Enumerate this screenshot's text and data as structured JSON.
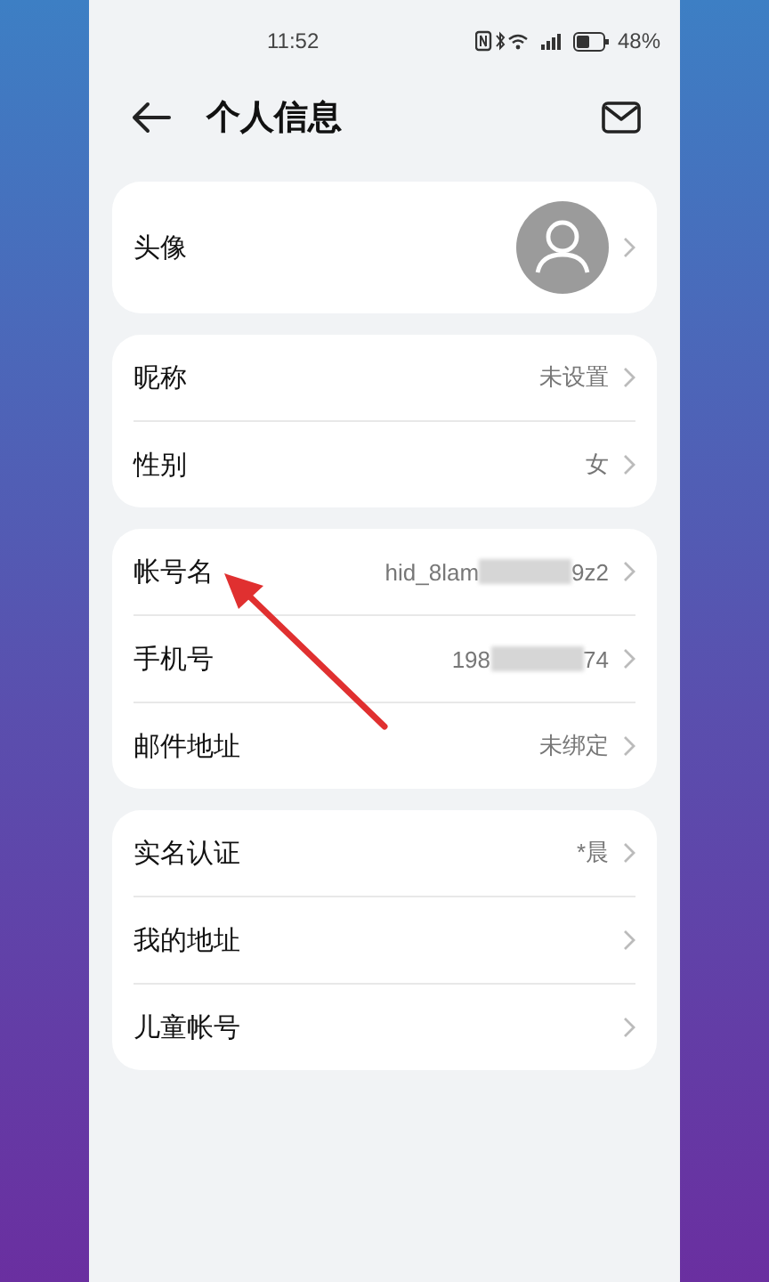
{
  "status_bar": {
    "time": "11:52",
    "battery": "48%",
    "battery_meter": {
      "level": 0.48
    }
  },
  "header": {
    "title": "个人信息"
  },
  "groups": [
    {
      "rows": [
        {
          "kind": "avatar",
          "label": "头像"
        }
      ]
    },
    {
      "rows": [
        {
          "kind": "text",
          "label": "昵称",
          "value": [
            {
              "kind": "text",
              "text": "未设置"
            }
          ]
        },
        {
          "kind": "text",
          "label": "性别",
          "value": [
            {
              "kind": "text",
              "text": "女"
            }
          ]
        }
      ]
    },
    {
      "rows": [
        {
          "kind": "text",
          "label": "帐号名",
          "value": [
            {
              "kind": "text",
              "text": "hid_8lam"
            },
            {
              "kind": "masked"
            },
            {
              "kind": "text",
              "text": "9z2"
            }
          ]
        },
        {
          "kind": "text",
          "label": "手机号",
          "value": [
            {
              "kind": "text",
              "text": "198"
            },
            {
              "kind": "masked"
            },
            {
              "kind": "text",
              "text": "74"
            }
          ]
        },
        {
          "kind": "text",
          "label": "邮件地址",
          "value": [
            {
              "kind": "text",
              "text": "未绑定"
            }
          ]
        }
      ]
    },
    {
      "rows": [
        {
          "kind": "text",
          "label": "实名认证",
          "value": [
            {
              "kind": "text",
              "text": "*晨"
            }
          ]
        },
        {
          "kind": "text",
          "label": "我的地址"
        },
        {
          "kind": "text",
          "label": "儿童帐号"
        }
      ]
    }
  ]
}
